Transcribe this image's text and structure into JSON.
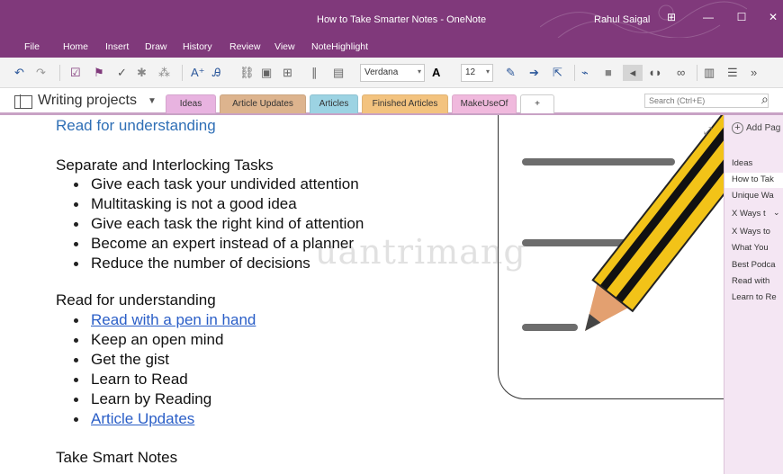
{
  "window": {
    "title": "How to Take Smarter Notes - OneNote",
    "user": "Rahul Saigal",
    "accent": "#80397b"
  },
  "menu": [
    "File",
    "Home",
    "Insert",
    "Draw",
    "History",
    "Review",
    "View",
    "NoteHighlight"
  ],
  "toolbar": {
    "font": "Verdana",
    "size": "12"
  },
  "notebook": {
    "name": "Writing projects"
  },
  "sections": [
    {
      "label": "Ideas",
      "color": "#e8b3e0"
    },
    {
      "label": "Article Updates",
      "color": "#ddb48e"
    },
    {
      "label": "Articles",
      "color": "#9cd3e3"
    },
    {
      "label": "Finished Articles",
      "color": "#f3c37f"
    },
    {
      "label": "MakeUseOf",
      "color": "#f0b9dd"
    },
    {
      "label": "+",
      "color": "#ffffff"
    }
  ],
  "search": {
    "placeholder": "Search (Ctrl+E)"
  },
  "note": {
    "heading_top": "Read for understanding",
    "group1_title": "Separate and Interlocking Tasks",
    "group1_items": [
      "Give each task your undivided attention",
      "Multitasking is not a good idea",
      "Give each task the right kind of attention",
      "Become an expert instead of a planner",
      "Reduce the number of decisions"
    ],
    "group2_title": "Read for understanding",
    "group2_items": [
      "Read with a pen in hand",
      "Keep an open mind",
      "Get the gist",
      "Learn to Read",
      "Learn by Reading",
      "Article Updates"
    ],
    "group3_title": "Take Smart Notes"
  },
  "watermark": "uantrimang",
  "pages_panel": {
    "add_label": "Add Pag",
    "items": [
      "Ideas",
      "How to Tak",
      "Unique Wa",
      "X Ways t",
      "X Ways to",
      "What You",
      "Best Podca",
      "Read with",
      "Learn to Re"
    ]
  }
}
